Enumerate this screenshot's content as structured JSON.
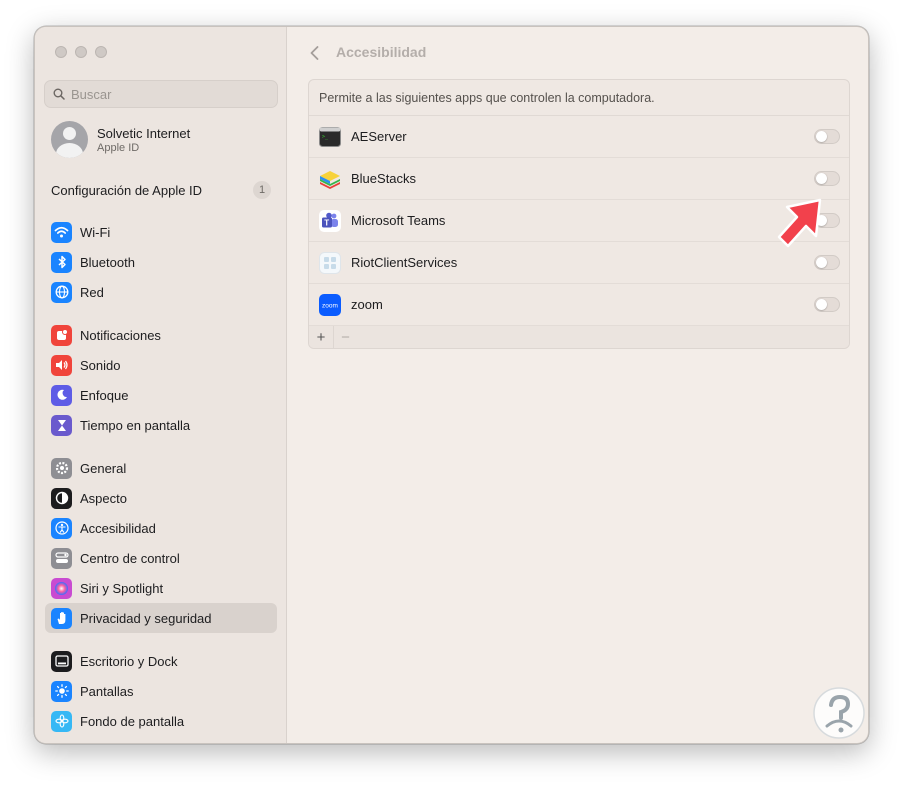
{
  "window": {
    "title": "Accesibilidad"
  },
  "sidebar": {
    "search_placeholder": "Buscar",
    "account": {
      "name": "Solvetic Internet",
      "subtitle": "Apple ID"
    },
    "appleid": {
      "label": "Configuración de Apple ID",
      "badge": "1"
    },
    "groups": [
      [
        {
          "label": "Wi-Fi",
          "icon": "wifi-icon",
          "color": "#1a84ff"
        },
        {
          "label": "Bluetooth",
          "icon": "bluetooth-icon",
          "color": "#1a84ff"
        },
        {
          "label": "Red",
          "icon": "globe-icon",
          "color": "#1a84ff"
        }
      ],
      [
        {
          "label": "Notificaciones",
          "icon": "bell-icon",
          "color": "#f0443b"
        },
        {
          "label": "Sonido",
          "icon": "speaker-icon",
          "color": "#f0443b"
        },
        {
          "label": "Enfoque",
          "icon": "moon-icon",
          "color": "#5e5ce6"
        },
        {
          "label": "Tiempo en pantalla",
          "icon": "hourglass-icon",
          "color": "#6a5acd"
        }
      ],
      [
        {
          "label": "General",
          "icon": "gear-icon",
          "color": "#8e8e93"
        },
        {
          "label": "Aspecto",
          "icon": "appearance-icon",
          "color": "#1c1c1e"
        },
        {
          "label": "Accesibilidad",
          "icon": "accessibility-icon",
          "color": "#1a84ff"
        },
        {
          "label": "Centro de control",
          "icon": "control-center-icon",
          "color": "#8e8e93"
        },
        {
          "label": "Siri y Spotlight",
          "icon": "siri-icon",
          "color": "#c94bd1"
        },
        {
          "label": "Privacidad y seguridad",
          "icon": "hand-icon",
          "color": "#1a84ff",
          "selected": true
        }
      ],
      [
        {
          "label": "Escritorio y Dock",
          "icon": "dock-icon",
          "color": "#1c1c1e"
        },
        {
          "label": "Pantallas",
          "icon": "sun-icon",
          "color": "#1a84ff"
        },
        {
          "label": "Fondo de pantalla",
          "icon": "flower-icon",
          "color": "#36b8f5"
        }
      ]
    ]
  },
  "main": {
    "description": "Permite a las siguientes apps que controlen la computadora.",
    "apps": [
      {
        "name": "AEServer",
        "icon": "terminal-icon",
        "enabled": false
      },
      {
        "name": "BlueStacks",
        "icon": "bluestacks-icon",
        "enabled": false
      },
      {
        "name": "Microsoft Teams",
        "icon": "teams-icon",
        "enabled": false
      },
      {
        "name": "RiotClientServices",
        "icon": "riot-icon",
        "enabled": false
      },
      {
        "name": "zoom",
        "icon": "zoom-icon",
        "enabled": false
      }
    ],
    "add_symbol": "+",
    "remove_symbol": "−"
  },
  "zoom_logo_text": "zoom"
}
